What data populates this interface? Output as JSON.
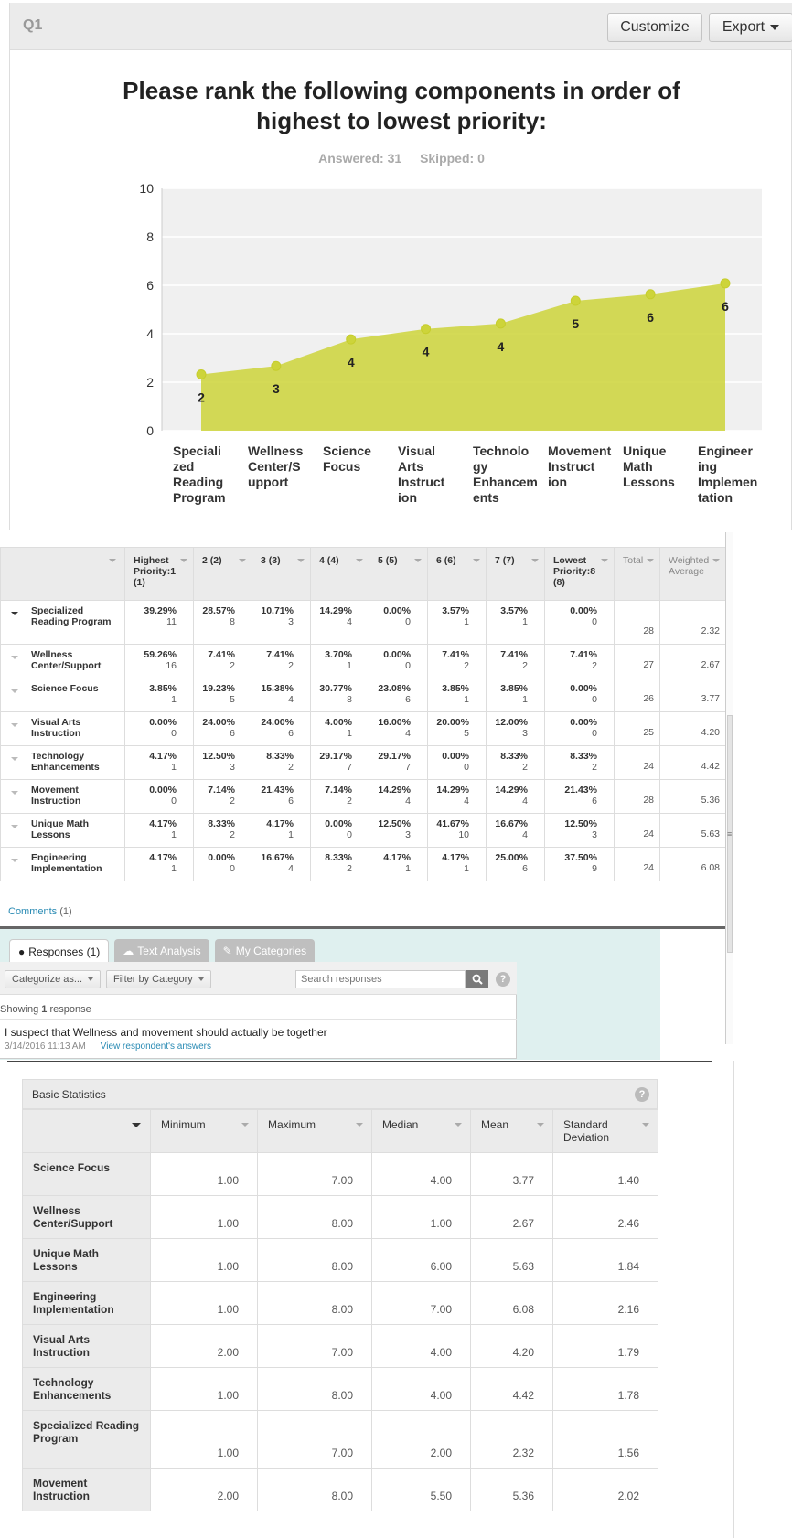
{
  "question": {
    "label": "Q1",
    "customize_label": "Customize",
    "export_label": "Export",
    "title": "Please rank the following components in order of highest to lowest priority:",
    "answered": "Answered: 31",
    "skipped": "Skipped: 0"
  },
  "chart_data": {
    "type": "area",
    "categories": [
      "Specialized Reading Program",
      "Wellness Center/Support",
      "Science Focus",
      "Visual Arts Instruction",
      "Technology Enhancements",
      "Movement Instruction",
      "Unique Math Lessons",
      "Engineering Implementation"
    ],
    "category_lines": [
      [
        "Speciali",
        "zed",
        "Reading",
        "Program"
      ],
      [
        "Wellness",
        "Center/S",
        "upport"
      ],
      [
        "Science",
        "Focus"
      ],
      [
        "Visual",
        "Arts",
        "Instruct",
        "ion"
      ],
      [
        "Technolo",
        "gy",
        "Enhancem",
        "ents"
      ],
      [
        "Movement",
        "Instruct",
        "ion"
      ],
      [
        "Unique",
        "Math",
        "Lessons"
      ],
      [
        "Engineer",
        "ing",
        "Implemen",
        "tation"
      ]
    ],
    "values": [
      2.32,
      2.67,
      3.77,
      4.2,
      4.42,
      5.36,
      5.63,
      6.08
    ],
    "data_labels": [
      "2",
      "3",
      "4",
      "4",
      "4",
      "5",
      "6",
      "6"
    ],
    "yticks": [
      "0",
      "2",
      "4",
      "6",
      "8",
      "10"
    ],
    "ylim": [
      0,
      10
    ],
    "color": "#cdd43a",
    "grid": true
  },
  "matrix": {
    "headers": [
      "Highest Priority:1 (1)",
      "2 (2)",
      "3 (3)",
      "4 (4)",
      "5 (5)",
      "6 (6)",
      "7 (7)",
      "Lowest Priority:8 (8)",
      "Total",
      "Weighted Average"
    ],
    "rows": [
      {
        "label": "Specialized Reading Program",
        "cells": [
          [
            "39.29%",
            "11"
          ],
          [
            "28.57%",
            "8"
          ],
          [
            "10.71%",
            "3"
          ],
          [
            "14.29%",
            "4"
          ],
          [
            "0.00%",
            "0"
          ],
          [
            "3.57%",
            "1"
          ],
          [
            "3.57%",
            "1"
          ],
          [
            "0.00%",
            "0"
          ]
        ],
        "total": "28",
        "wavg": "2.32"
      },
      {
        "label": "Wellness Center/Support",
        "cells": [
          [
            "59.26%",
            "16"
          ],
          [
            "7.41%",
            "2"
          ],
          [
            "7.41%",
            "2"
          ],
          [
            "3.70%",
            "1"
          ],
          [
            "0.00%",
            "0"
          ],
          [
            "7.41%",
            "2"
          ],
          [
            "7.41%",
            "2"
          ],
          [
            "7.41%",
            "2"
          ]
        ],
        "total": "27",
        "wavg": "2.67"
      },
      {
        "label": "Science Focus",
        "cells": [
          [
            "3.85%",
            "1"
          ],
          [
            "19.23%",
            "5"
          ],
          [
            "15.38%",
            "4"
          ],
          [
            "30.77%",
            "8"
          ],
          [
            "23.08%",
            "6"
          ],
          [
            "3.85%",
            "1"
          ],
          [
            "3.85%",
            "1"
          ],
          [
            "0.00%",
            "0"
          ]
        ],
        "total": "26",
        "wavg": "3.77"
      },
      {
        "label": "Visual Arts Instruction",
        "cells": [
          [
            "0.00%",
            "0"
          ],
          [
            "24.00%",
            "6"
          ],
          [
            "24.00%",
            "6"
          ],
          [
            "4.00%",
            "1"
          ],
          [
            "16.00%",
            "4"
          ],
          [
            "20.00%",
            "5"
          ],
          [
            "12.00%",
            "3"
          ],
          [
            "0.00%",
            "0"
          ]
        ],
        "total": "25",
        "wavg": "4.20"
      },
      {
        "label": "Technology Enhancements",
        "cells": [
          [
            "4.17%",
            "1"
          ],
          [
            "12.50%",
            "3"
          ],
          [
            "8.33%",
            "2"
          ],
          [
            "29.17%",
            "7"
          ],
          [
            "29.17%",
            "7"
          ],
          [
            "0.00%",
            "0"
          ],
          [
            "8.33%",
            "2"
          ],
          [
            "8.33%",
            "2"
          ]
        ],
        "total": "24",
        "wavg": "4.42"
      },
      {
        "label": "Movement Instruction",
        "cells": [
          [
            "0.00%",
            "0"
          ],
          [
            "7.14%",
            "2"
          ],
          [
            "21.43%",
            "6"
          ],
          [
            "7.14%",
            "2"
          ],
          [
            "14.29%",
            "4"
          ],
          [
            "14.29%",
            "4"
          ],
          [
            "14.29%",
            "4"
          ],
          [
            "21.43%",
            "6"
          ]
        ],
        "total": "28",
        "wavg": "5.36"
      },
      {
        "label": "Unique Math Lessons",
        "cells": [
          [
            "4.17%",
            "1"
          ],
          [
            "8.33%",
            "2"
          ],
          [
            "4.17%",
            "1"
          ],
          [
            "0.00%",
            "0"
          ],
          [
            "12.50%",
            "3"
          ],
          [
            "41.67%",
            "10"
          ],
          [
            "16.67%",
            "4"
          ],
          [
            "12.50%",
            "3"
          ]
        ],
        "total": "24",
        "wavg": "5.63"
      },
      {
        "label": "Engineering Implementation",
        "cells": [
          [
            "4.17%",
            "1"
          ],
          [
            "0.00%",
            "0"
          ],
          [
            "16.67%",
            "4"
          ],
          [
            "8.33%",
            "2"
          ],
          [
            "4.17%",
            "1"
          ],
          [
            "4.17%",
            "1"
          ],
          [
            "25.00%",
            "6"
          ],
          [
            "37.50%",
            "9"
          ]
        ],
        "total": "24",
        "wavg": "6.08"
      }
    ]
  },
  "comments": {
    "label": "Comments",
    "count": "(1)"
  },
  "responses": {
    "tabs": [
      "Responses (1)",
      "Text Analysis",
      "My Categories"
    ],
    "categorize_label": "Categorize as...",
    "filter_label": "Filter by Category",
    "search_placeholder": "Search responses",
    "showing_prefix": "Showing ",
    "showing_count": "1",
    "showing_suffix": " response",
    "text": "I suspect that Wellness and movement should actually be together",
    "date": "3/14/2016 11:13 AM",
    "view_link": "View respondent's answers"
  },
  "stats": {
    "title": "Basic Statistics",
    "headers": [
      "Minimum",
      "Maximum",
      "Median",
      "Mean",
      "Standard Deviation"
    ],
    "rows": [
      {
        "label": "Science Focus",
        "values": [
          "1.00",
          "7.00",
          "4.00",
          "3.77",
          "1.40"
        ]
      },
      {
        "label": "Wellness Center/Support",
        "values": [
          "1.00",
          "8.00",
          "1.00",
          "2.67",
          "2.46"
        ]
      },
      {
        "label": "Unique Math Lessons",
        "values": [
          "1.00",
          "8.00",
          "6.00",
          "5.63",
          "1.84"
        ]
      },
      {
        "label": "Engineering Implementation",
        "values": [
          "1.00",
          "8.00",
          "7.00",
          "6.08",
          "2.16"
        ]
      },
      {
        "label": "Visual Arts Instruction",
        "values": [
          "2.00",
          "7.00",
          "4.00",
          "4.20",
          "1.79"
        ]
      },
      {
        "label": "Technology Enhancements",
        "values": [
          "1.00",
          "8.00",
          "4.00",
          "4.42",
          "1.78"
        ]
      },
      {
        "label": "Specialized Reading Program",
        "values": [
          "1.00",
          "7.00",
          "2.00",
          "2.32",
          "1.56"
        ]
      },
      {
        "label": "Movement Instruction",
        "values": [
          "2.00",
          "8.00",
          "5.50",
          "5.36",
          "2.02"
        ]
      }
    ]
  }
}
